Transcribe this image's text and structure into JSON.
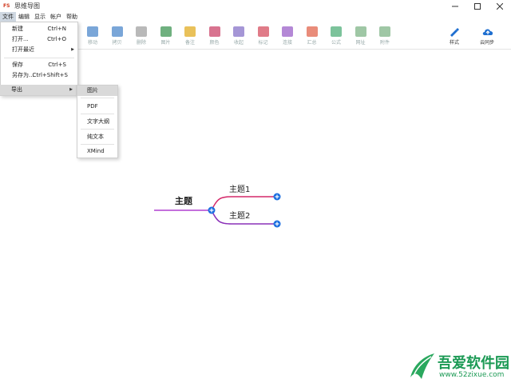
{
  "window": {
    "title": "思维导图",
    "app_icon_text": "FS"
  },
  "menubar": {
    "items": [
      "文件",
      "编辑",
      "显示",
      "帐户",
      "帮助"
    ]
  },
  "toolbar": {
    "tools": [
      {
        "label": "移动",
        "icon": "move-icon",
        "color": "#7aa6d8"
      },
      {
        "label": "拷贝",
        "icon": "copy-icon",
        "color": "#7aa6d8"
      },
      {
        "label": "删除",
        "icon": "trash-icon",
        "color": "#b9b9b9"
      },
      {
        "label": "图片",
        "icon": "image-icon",
        "color": "#6fb07f"
      },
      {
        "label": "备注",
        "icon": "note-icon",
        "color": "#e9c15a"
      },
      {
        "label": "颜色",
        "icon": "palette-icon",
        "color": "#d8738f"
      },
      {
        "label": "收起",
        "icon": "collapse-icon",
        "color": "#a596d6"
      },
      {
        "label": "标记",
        "icon": "flag-icon",
        "color": "#e07b88"
      },
      {
        "label": "连接",
        "icon": "connect-icon",
        "color": "#b488d6"
      },
      {
        "label": "汇总",
        "icon": "summary-icon",
        "color": "#e98c7a"
      },
      {
        "label": "公式",
        "icon": "formula-icon",
        "color": "#7cc39b"
      },
      {
        "label": "网址",
        "icon": "link-icon",
        "color": "#9fc7a5"
      },
      {
        "label": "附件",
        "icon": "attachment-icon",
        "color": "#9fc7a5"
      }
    ],
    "right_tools": [
      {
        "label": "样式",
        "icon": "style-brush-icon",
        "color": "#1f6fd0"
      },
      {
        "label": "云同步",
        "icon": "cloud-upload-icon",
        "color": "#1f6fd0"
      }
    ]
  },
  "file_menu": {
    "items": [
      {
        "label": "新建",
        "shortcut": "Ctrl+N"
      },
      {
        "label": "打开...",
        "shortcut": "Ctrl+O"
      },
      {
        "label": "打开最近",
        "shortcut": ""
      },
      {
        "label": "保存",
        "shortcut": "Ctrl+S"
      },
      {
        "label": "另存为...",
        "shortcut": "Ctrl+Shift+S"
      }
    ],
    "export_label": "导出"
  },
  "export_submenu": {
    "items": [
      "图片",
      "PDF",
      "文字大纲",
      "纯文本",
      "XMind"
    ]
  },
  "mindmap": {
    "root": "主题",
    "children": [
      "主题1",
      "主题2"
    ],
    "colors": {
      "root_line": "#b040d0",
      "branch_1": "#d4296a",
      "branch_2": "#8a30b8",
      "node_badge": "#1c6fe0"
    }
  },
  "watermark": {
    "title": "吾爱软件园",
    "url": "www.52zixue.com",
    "color": "#1c9a55"
  }
}
